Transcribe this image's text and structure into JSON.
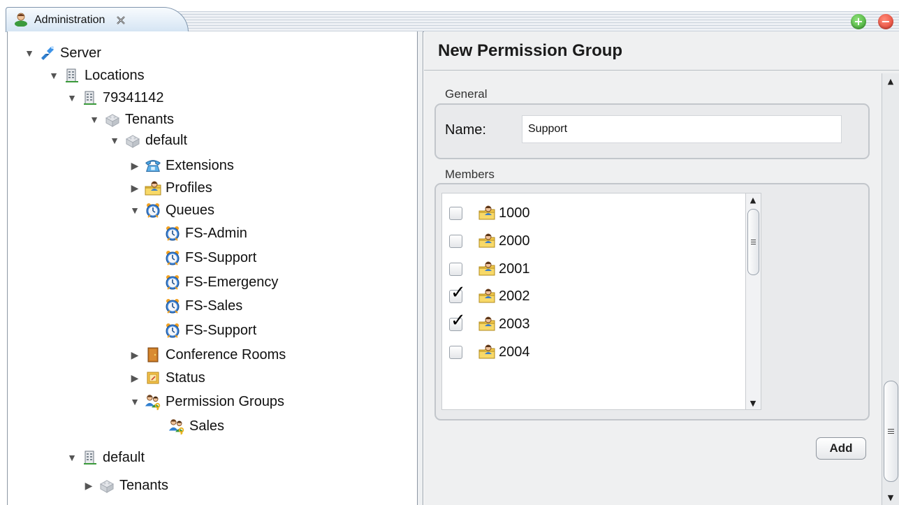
{
  "tab": {
    "title": "Administration",
    "icon": "user-admin-icon"
  },
  "window_buttons": {
    "add": "+",
    "remove": "−"
  },
  "tree": [
    {
      "label": "Server",
      "expand": "expanded",
      "icon": "server-icon"
    },
    {
      "label": "Locations",
      "expand": "expanded",
      "icon": "building-icon"
    },
    {
      "label": "79341142",
      "expand": "expanded",
      "icon": "building-icon"
    },
    {
      "label": "Tenants",
      "expand": "expanded",
      "icon": "tenants-icon"
    },
    {
      "label": "default",
      "expand": "expanded",
      "icon": "tenants-icon"
    },
    {
      "label": "Extensions",
      "expand": "collapsed",
      "icon": "phone-icon"
    },
    {
      "label": "Profiles",
      "expand": "collapsed",
      "icon": "profile-folder-icon"
    },
    {
      "label": "Queues",
      "expand": "expanded",
      "icon": "clock-icon"
    },
    {
      "label": "FS-Admin",
      "expand": "none",
      "icon": "clock-icon"
    },
    {
      "label": "FS-Support",
      "expand": "none",
      "icon": "clock-icon"
    },
    {
      "label": "FS-Emergency",
      "expand": "none",
      "icon": "clock-icon"
    },
    {
      "label": "FS-Sales",
      "expand": "none",
      "icon": "clock-icon"
    },
    {
      "label": "FS-Support",
      "expand": "none",
      "icon": "clock-icon"
    },
    {
      "label": "Conference Rooms",
      "expand": "collapsed",
      "icon": "door-icon"
    },
    {
      "label": "Status",
      "expand": "collapsed",
      "icon": "status-icon"
    },
    {
      "label": "Permission Groups",
      "expand": "expanded",
      "icon": "users-key-icon"
    },
    {
      "label": "Sales",
      "expand": "none",
      "icon": "users-key-icon"
    },
    {
      "label": "default",
      "expand": "expanded",
      "icon": "building-icon"
    },
    {
      "label": "Tenants",
      "expand": "collapsed",
      "icon": "tenants-icon"
    }
  ],
  "form": {
    "title": "New Permission Group",
    "general_label": "General",
    "name_label": "Name:",
    "name_value": "Support",
    "members_label": "Members",
    "members": [
      {
        "label": "1000",
        "checked": false
      },
      {
        "label": "2000",
        "checked": false
      },
      {
        "label": "2001",
        "checked": false
      },
      {
        "label": "2002",
        "checked": true
      },
      {
        "label": "2003",
        "checked": true
      },
      {
        "label": "2004",
        "checked": false
      }
    ],
    "add_button": "Add"
  }
}
